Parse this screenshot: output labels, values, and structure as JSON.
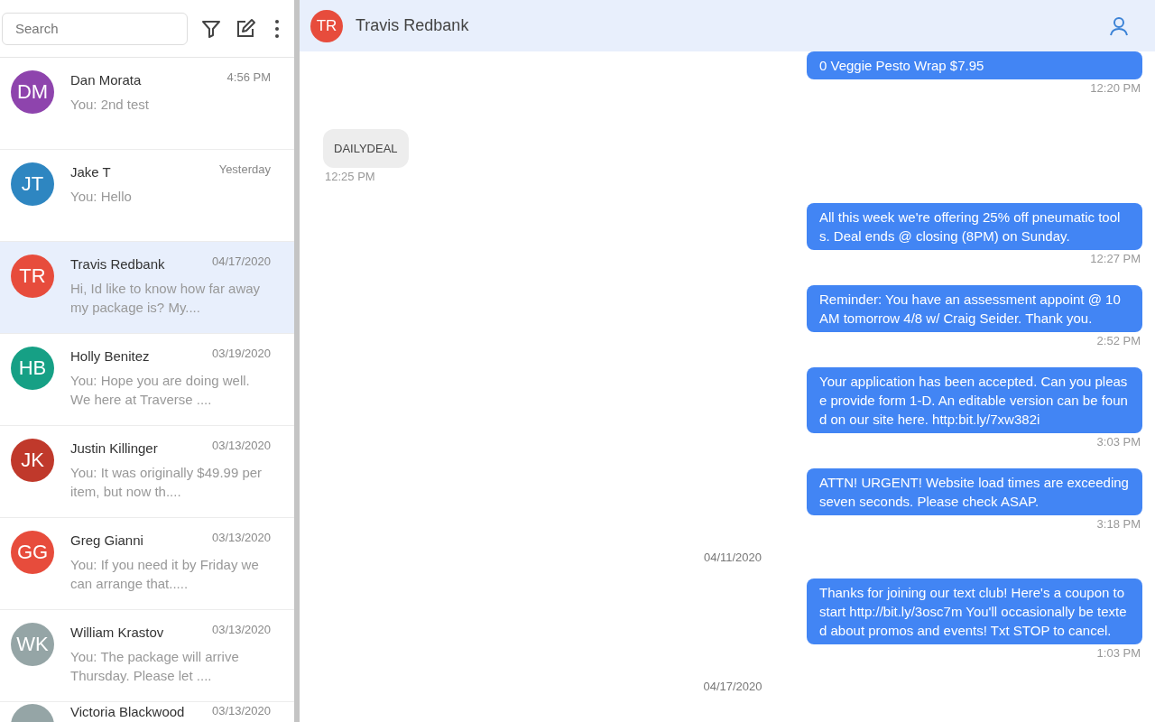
{
  "sidebar": {
    "search": {
      "placeholder": "Search"
    },
    "conversations": [
      {
        "initials": "DM",
        "color": "#8e44ad",
        "name": "Dan Morata",
        "time": "4:56 PM",
        "preview": "You: 2nd test",
        "selected": false
      },
      {
        "initials": "JT",
        "color": "#2e86c1",
        "name": "Jake T",
        "time": "Yesterday",
        "preview": "You: Hello",
        "selected": false
      },
      {
        "initials": "TR",
        "color": "#e74c3c",
        "name": "Travis Redbank",
        "time": "04/17/2020",
        "preview": "Hi, Id like to know how far away my package is? My....",
        "selected": true
      },
      {
        "initials": "HB",
        "color": "#16a085",
        "name": "Holly Benitez",
        "time": "03/19/2020",
        "preview": "You: Hope you are doing well. We here at Traverse ....",
        "selected": false
      },
      {
        "initials": "JK",
        "color": "#c0392b",
        "name": "Justin Killinger",
        "time": "03/13/2020",
        "preview": "You: It was originally $49.99 per item, but now th....",
        "selected": false
      },
      {
        "initials": "GG",
        "color": "#e74c3c",
        "name": "Greg Gianni",
        "time": "03/13/2020",
        "preview": "You: If you need it by Friday we can arrange that.....",
        "selected": false
      },
      {
        "initials": "WK",
        "color": "#95a5a6",
        "name": "William Krastov",
        "time": "03/13/2020",
        "preview": "You: The package will arrive Thursday. Please let ....",
        "selected": false
      },
      {
        "color": "#95a5a6",
        "name": "Victoria Blackwood",
        "time": "03/13/2020",
        "selected": false
      }
    ]
  },
  "chat": {
    "contact": {
      "initials": "TR",
      "color": "#e74c3c",
      "name": "Travis Redbank"
    },
    "messages": [
      {
        "kind": "outgoing",
        "text": "0 Veggie Pesto Wrap $7.95",
        "time": "12:20 PM"
      },
      {
        "kind": "incoming",
        "text": "DAILYDEAL",
        "time": "12:25 PM"
      },
      {
        "kind": "outgoing",
        "text": "All this week we're offering 25% off pneumatic tools. Deal ends @ closing (8PM) on Sunday.",
        "time": "12:27 PM"
      },
      {
        "kind": "outgoing",
        "text": "Reminder: You have an assessment appoint @ 10 AM tomorrow 4/8 w/ Craig Seider. Thank you.",
        "time": "2:52 PM"
      },
      {
        "kind": "outgoing",
        "text": "Your application has been accepted. Can you please provide form 1-D. An editable version can be found on our site here. http:bit.ly/7xw382i",
        "time": "3:03 PM"
      },
      {
        "kind": "outgoing",
        "text": "ATTN! URGENT! Website load times are exceeding seven seconds. Please check ASAP.",
        "time": "3:18 PM"
      },
      {
        "kind": "date",
        "text": "04/11/2020"
      },
      {
        "kind": "outgoing",
        "text": "Thanks for joining our text club! Here's a coupon to start http://bit.ly/3osc7m You'll occasionally be texted about promos and events! Txt STOP to cancel.",
        "time": "1:03 PM"
      },
      {
        "kind": "date",
        "text": "04/17/2020"
      }
    ]
  }
}
